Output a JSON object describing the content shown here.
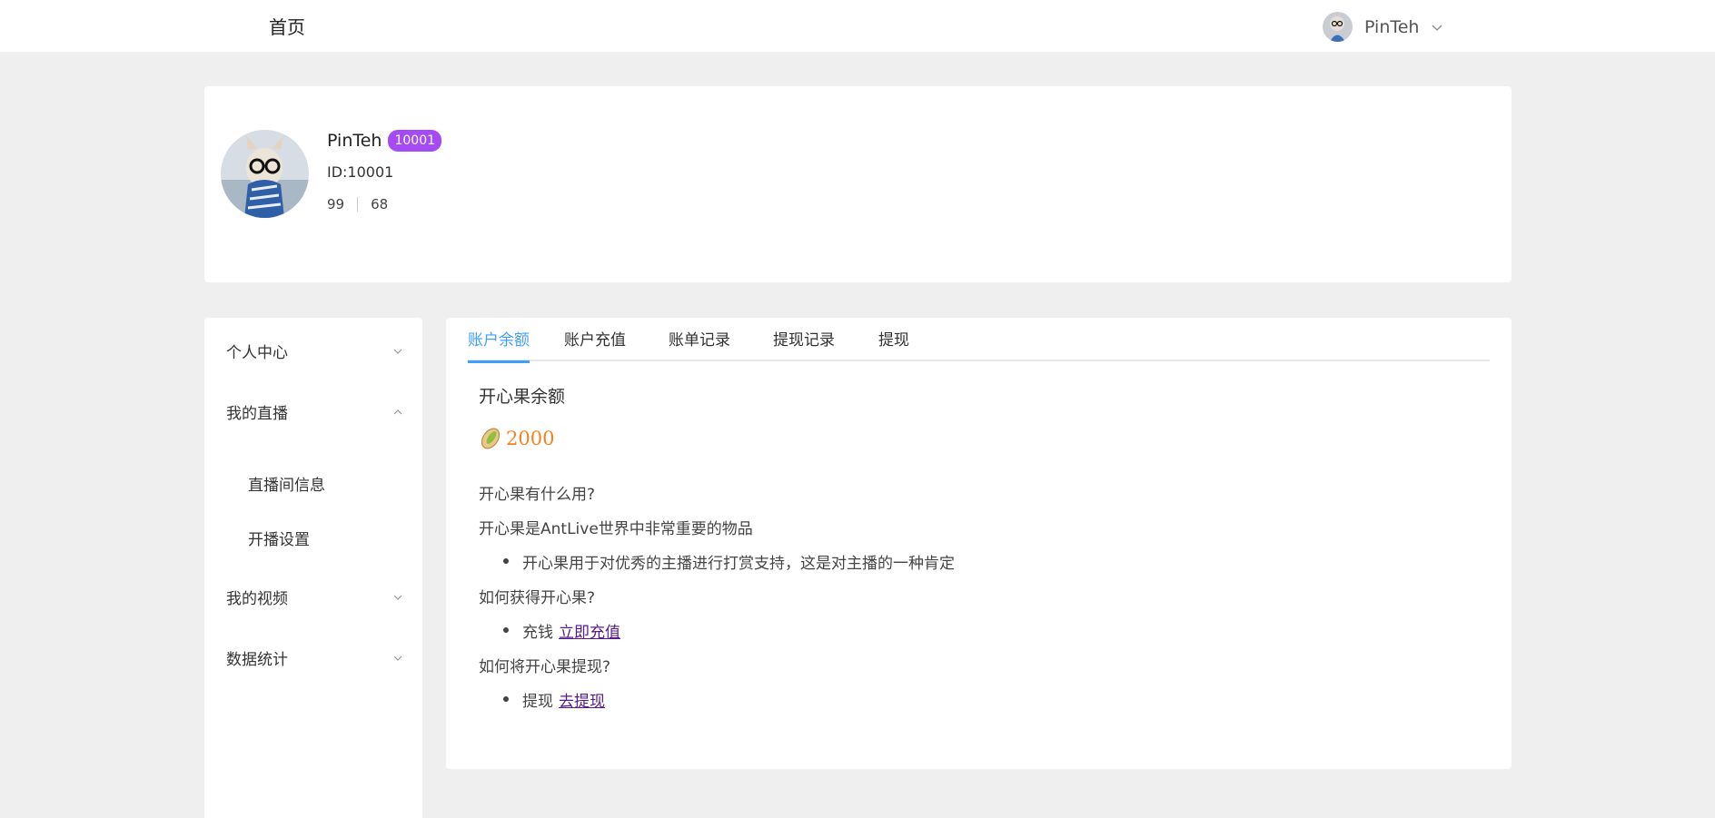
{
  "topbar": {
    "home_label": "首页",
    "username": "PinTeh"
  },
  "profile": {
    "name": "PinTeh",
    "badge": "10001",
    "id_text": "ID:10001",
    "stat_a": "99",
    "stat_b": "68"
  },
  "sidebar": {
    "items": [
      {
        "label": "个人中心",
        "icon": "chevron-down-icon"
      },
      {
        "label": "我的直播",
        "icon": "chevron-up-icon"
      },
      {
        "label": "我的视频",
        "icon": "chevron-down-icon"
      },
      {
        "label": "数据统计",
        "icon": "chevron-down-icon"
      }
    ],
    "sub_items": [
      {
        "label": "直播间信息"
      },
      {
        "label": "开播设置"
      }
    ]
  },
  "tabs": [
    {
      "label": "账户余额",
      "active": true
    },
    {
      "label": "账户充值",
      "active": false
    },
    {
      "label": "账单记录",
      "active": false
    },
    {
      "label": "提现记录",
      "active": false
    },
    {
      "label": "提现",
      "active": false
    }
  ],
  "balance": {
    "title": "开心果余额",
    "icon": "pistachio-icon",
    "value": "2000"
  },
  "faq": {
    "q1": "开心果有什么用?",
    "a1": "开心果是AntLive世界中非常重要的物品",
    "a1_bullet": "开心果用于对优秀的主播进行打赏支持，这是对主播的一种肯定",
    "q2": "如何获得开心果?",
    "a2_text": "充钱",
    "a2_link": "立即充值",
    "q3": "如何将开心果提现?",
    "a3_text": "提现",
    "a3_link": "去提现"
  },
  "colors": {
    "accent": "#409eff",
    "badge": "#a64bf4",
    "balance": "#f5821f",
    "link": "#551a8b"
  }
}
